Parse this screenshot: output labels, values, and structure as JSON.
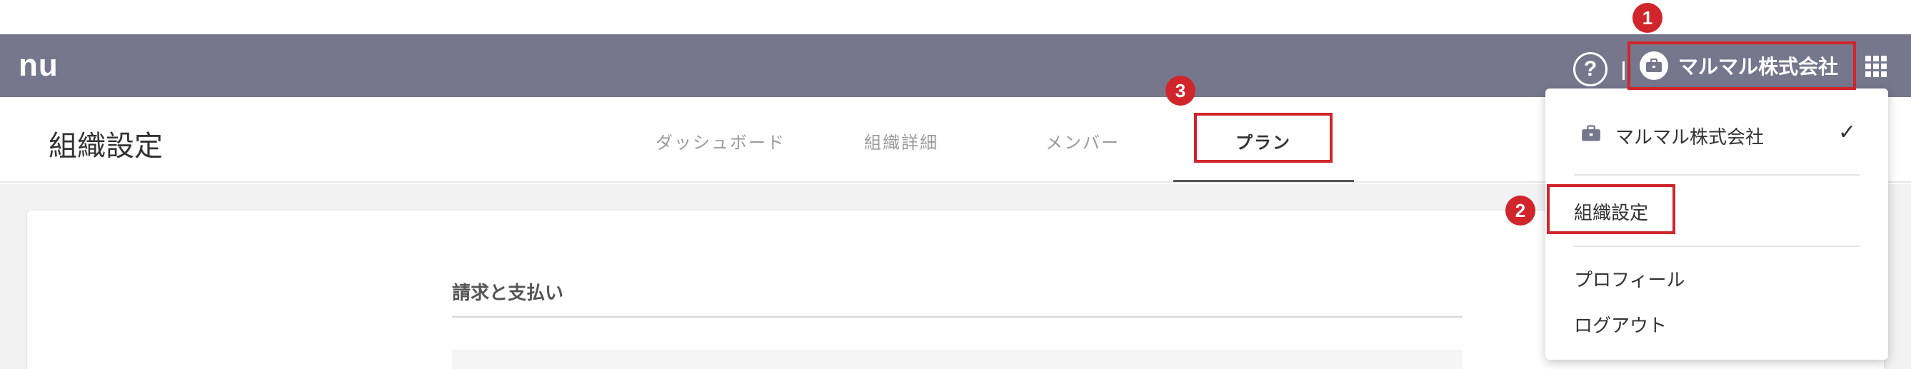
{
  "app": {
    "logo": "nu"
  },
  "header": {
    "help_label": "?",
    "org_name": "マルマル株式会社"
  },
  "subnav": {
    "page_title": "組織設定",
    "tabs": [
      {
        "label": "ダッシュボード"
      },
      {
        "label": "組織詳細"
      },
      {
        "label": "メンバー"
      },
      {
        "label": "プラン",
        "active": true
      }
    ]
  },
  "content": {
    "section_title": "請求と支払い"
  },
  "dropdown": {
    "org_name": "マルマル株式会社",
    "check": "✓",
    "items": [
      {
        "label": "組織設定"
      },
      {
        "label": "プロフィール"
      },
      {
        "label": "ログアウト"
      }
    ]
  },
  "annotations": {
    "badges": [
      "1",
      "2",
      "3"
    ],
    "color": "#d0252b"
  },
  "colors": {
    "header_bg": "#76778d",
    "accent": "#d0252b"
  }
}
